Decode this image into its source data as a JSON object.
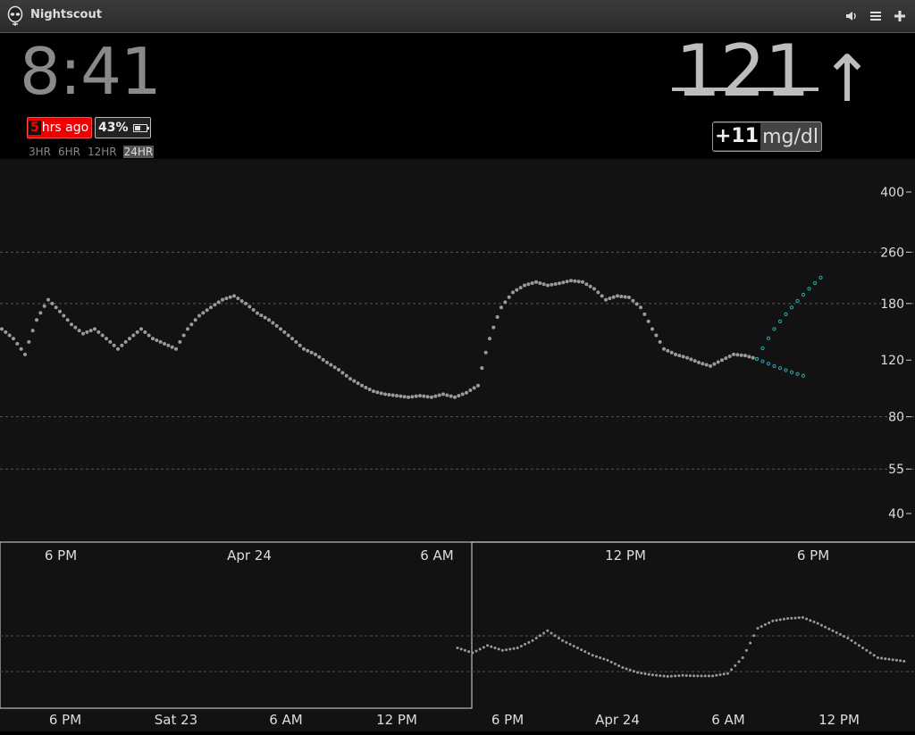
{
  "header": {
    "title": "Nightscout"
  },
  "status": {
    "time": "8:41",
    "ago_num": "5",
    "ago_label": "hrs ago",
    "battery": "43%",
    "ranges": [
      "3HR",
      "6HR",
      "12HR",
      "24HR"
    ],
    "active_range": "24HR"
  },
  "bg": {
    "value": "121",
    "arrow": "↑",
    "delta": "+11",
    "units": "mg/dl"
  },
  "colors": {
    "forecast": "#27a9b6",
    "point": "#9a9a9a",
    "alert": "#e00000"
  },
  "chart_data": [
    {
      "type": "scatter",
      "y_ticks": [
        400,
        260,
        180,
        120,
        80,
        55,
        40
      ],
      "x_ticks": [
        "6 PM",
        "Apr 24",
        "6 AM",
        "12 PM",
        "6 PM"
      ],
      "target_lines": [
        260,
        180,
        80,
        55
      ],
      "series": [
        {
          "values": [
            [
              0,
              150
            ],
            [
              2,
              140
            ],
            [
              4,
              125
            ],
            [
              6,
              160
            ],
            [
              8,
              185
            ],
            [
              10,
              170
            ],
            [
              12,
              155
            ],
            [
              14,
              145
            ],
            [
              16,
              150
            ],
            [
              18,
              140
            ],
            [
              20,
              130
            ],
            [
              22,
              140
            ],
            [
              24,
              150
            ],
            [
              26,
              140
            ],
            [
              28,
              135
            ],
            [
              30,
              130
            ],
            [
              32,
              150
            ],
            [
              34,
              165
            ],
            [
              36,
              175
            ],
            [
              38,
              185
            ],
            [
              40,
              190
            ],
            [
              42,
              180
            ],
            [
              44,
              168
            ],
            [
              46,
              160
            ],
            [
              48,
              150
            ],
            [
              50,
              140
            ],
            [
              52,
              130
            ],
            [
              54,
              125
            ],
            [
              56,
              118
            ],
            [
              58,
              112
            ],
            [
              60,
              105
            ],
            [
              62,
              100
            ],
            [
              64,
              96
            ],
            [
              66,
              94
            ],
            [
              68,
              93
            ],
            [
              70,
              92
            ],
            [
              72,
              93
            ],
            [
              74,
              92
            ],
            [
              76,
              94
            ],
            [
              78,
              92
            ],
            [
              80,
              95
            ],
            [
              82,
              100
            ],
            [
              84,
              140
            ],
            [
              86,
              175
            ],
            [
              88,
              195
            ],
            [
              90,
              205
            ],
            [
              92,
              210
            ],
            [
              94,
              205
            ],
            [
              96,
              208
            ],
            [
              98,
              212
            ],
            [
              100,
              210
            ],
            [
              102,
              200
            ],
            [
              104,
              185
            ],
            [
              106,
              190
            ],
            [
              108,
              188
            ],
            [
              110,
              175
            ],
            [
              112,
              150
            ],
            [
              114,
              130
            ],
            [
              116,
              125
            ],
            [
              118,
              122
            ],
            [
              120,
              118
            ],
            [
              122,
              115
            ],
            [
              124,
              120
            ],
            [
              126,
              125
            ],
            [
              128,
              124
            ],
            [
              130,
              121
            ]
          ]
        },
        {
          "values": [
            [
              130,
              121
            ],
            [
              133,
              150
            ],
            [
              136,
              175
            ],
            [
              139,
              200
            ],
            [
              142,
              225
            ]
          ]
        },
        {
          "values": [
            [
              130,
              121
            ],
            [
              133,
              115
            ],
            [
              136,
              110
            ],
            [
              139,
              106
            ]
          ]
        }
      ]
    },
    {
      "type": "scatter",
      "x_ticks": [
        "6 PM",
        "Sat 23",
        "6 AM",
        "12 PM",
        "6 PM",
        "Apr 24",
        "6 AM",
        "12 PM"
      ],
      "series": [
        {
          "values": [
            [
              0,
              150
            ],
            [
              3,
              140
            ],
            [
              6,
              155
            ],
            [
              9,
              145
            ],
            [
              12,
              150
            ],
            [
              15,
              165
            ],
            [
              18,
              185
            ],
            [
              21,
              165
            ],
            [
              24,
              150
            ],
            [
              27,
              135
            ],
            [
              30,
              125
            ],
            [
              33,
              110
            ],
            [
              36,
              100
            ],
            [
              39,
              95
            ],
            [
              42,
              92
            ],
            [
              45,
              94
            ],
            [
              48,
              93
            ],
            [
              51,
              93
            ],
            [
              54,
              98
            ],
            [
              57,
              130
            ],
            [
              60,
              190
            ],
            [
              63,
              205
            ],
            [
              66,
              210
            ],
            [
              69,
              212
            ],
            [
              72,
              200
            ],
            [
              75,
              185
            ],
            [
              78,
              170
            ],
            [
              81,
              150
            ],
            [
              84,
              130
            ],
            [
              87,
              126
            ],
            [
              90,
              122
            ]
          ]
        }
      ]
    }
  ]
}
